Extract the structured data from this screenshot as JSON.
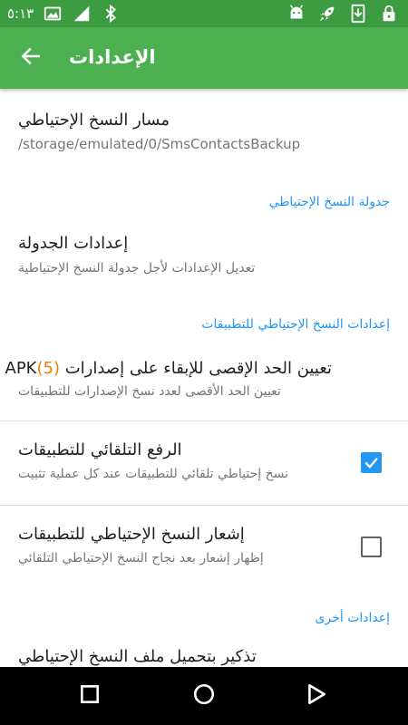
{
  "status_bar": {
    "time": "٥:١٣",
    "left_icons": [
      "image-icon",
      "signal-icon",
      "bluetooth-icon"
    ],
    "right_icons": [
      "android-icon",
      "rocket-icon",
      "download-icon",
      "lock-icon"
    ]
  },
  "app_bar": {
    "title": "الإعدادات",
    "back_icon": "arrow-back-icon",
    "color": "#4caf50"
  },
  "preferences": {
    "backup_path": {
      "title": "مسار النسخ الإحتياطي",
      "summary": "/storage/emulated/0/SmsContactsBackup"
    },
    "schedule_category": "جدولة النسخ الإحتياطي",
    "schedule_settings": {
      "title": "إعدادات الجدولة",
      "summary": "تعديل الإعدادات لأجل جدولة النسخ الإحتياطية"
    },
    "apps_category": "إعدادات النسخ الإحتياطي للتطبيقات",
    "max_apk": {
      "title_prefix": "تعيين الحد الإقصى للإبقاء على إصدارات ",
      "count": "(5)",
      "title_suffix": "APK",
      "summary": "تعيين الحد الأقصى لعدد نسخ الإصدارات للتطبيقات"
    },
    "auto_upload": {
      "title": "الرفع التلقائي للتطبيقات",
      "summary": "نسخ إحتياطي تلقائي للتطبيقات عند كل عملية تثبيت",
      "checked": true
    },
    "backup_notification": {
      "title": "إشعار النسخ الإحتياطي للتطبيقات",
      "summary": "إظهار إشعار بعد نجاح النسخ الإحتياطي التلقائي",
      "checked": false
    },
    "other_category": "إعدادات أخرى",
    "reminder": {
      "title": "تذكير بتحميل ملف النسخ الإحتياطي"
    }
  },
  "nav_bar": {
    "buttons": [
      "recents-square-icon",
      "home-circle-icon",
      "back-triangle-icon"
    ]
  },
  "colors": {
    "status_bar": "#3d9b41",
    "accent": "#2196f3",
    "apk_count": "#f57c00"
  }
}
